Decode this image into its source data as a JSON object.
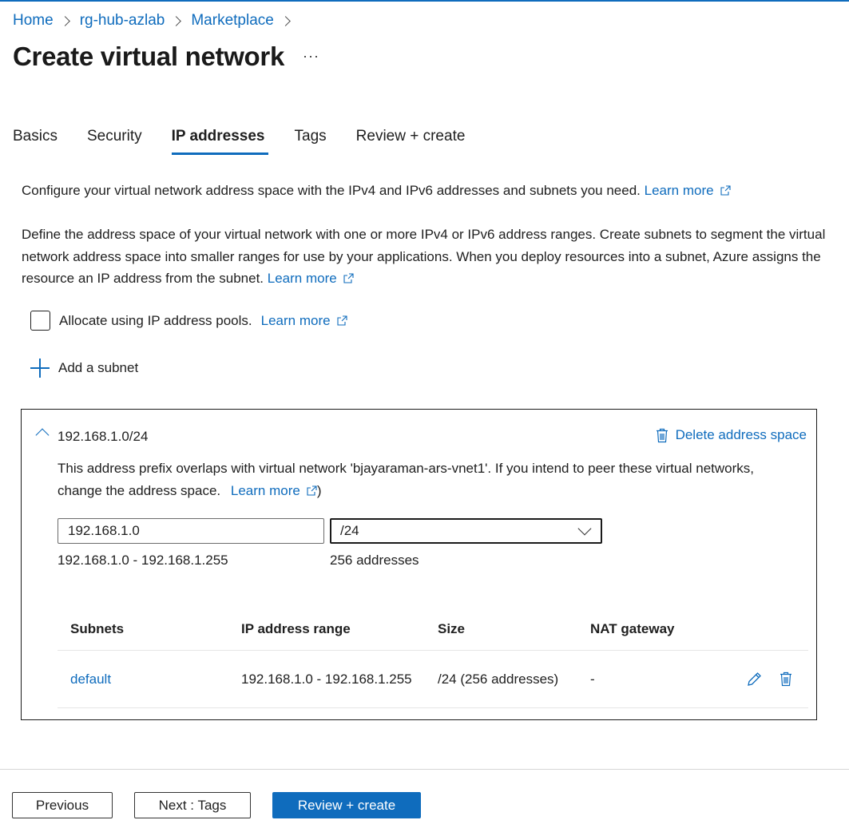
{
  "breadcrumb": {
    "items": [
      "Home",
      "rg-hub-azlab",
      "Marketplace"
    ]
  },
  "page": {
    "title": "Create virtual network",
    "more": "···"
  },
  "tabs": [
    {
      "label": "Basics"
    },
    {
      "label": "Security"
    },
    {
      "label": "IP addresses"
    },
    {
      "label": "Tags"
    },
    {
      "label": "Review + create"
    }
  ],
  "active_tab": "IP addresses",
  "intro": {
    "text1": "Configure your virtual network address space with the IPv4 and IPv6 addresses and subnets you need.",
    "text2": "Define the address space of your virtual network with one or more IPv4 or IPv6 address ranges. Create subnets to segment the virtual network address space into smaller ranges for use by your applications. When you deploy resources into a subnet, Azure assigns the resource an IP address from the subnet.",
    "learn_more": "Learn more"
  },
  "allocate": {
    "label": "Allocate using IP address pools.",
    "learn_more": "Learn more",
    "checked": false
  },
  "add_subnet": {
    "label": "Add a subnet"
  },
  "address_space": {
    "title": "192.168.1.0/24",
    "delete_label": "Delete address space",
    "warning": "This address prefix overlaps with virtual network 'bjayaraman-ars-vnet1'. If you intend to peer these virtual networks, change the address space.",
    "learn_more": "Learn more",
    "warning_close": ")",
    "ip_value": "192.168.1.0",
    "prefix_value": "/24",
    "range_text": "192.168.1.0 - 192.168.1.255",
    "count_text": "256 addresses"
  },
  "subnets_table": {
    "headers": [
      "Subnets",
      "IP address range",
      "Size",
      "NAT gateway"
    ],
    "rows": [
      {
        "name": "default",
        "range": "192.168.1.0 - 192.168.1.255",
        "size": "/24 (256 addresses)",
        "nat": "-"
      }
    ]
  },
  "footer": {
    "previous": "Previous",
    "next": "Next : Tags",
    "review": "Review + create"
  },
  "colors": {
    "accent": "#0f6cbd",
    "text": "#1f1f1f",
    "border": "#1a1a1a"
  }
}
